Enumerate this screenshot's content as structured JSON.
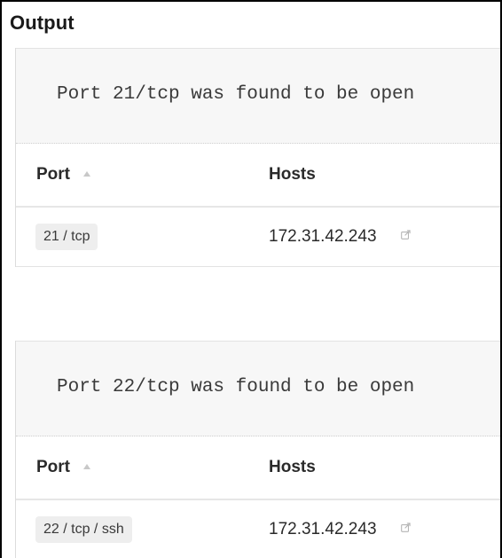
{
  "section": {
    "title": "Output"
  },
  "results": [
    {
      "message": "Port 21/tcp was found to be open",
      "columns": {
        "port": "Port",
        "hosts": "Hosts"
      },
      "rows": [
        {
          "port": "21 / tcp",
          "host": "172.31.42.243"
        }
      ]
    },
    {
      "message": "Port 22/tcp was found to be open",
      "columns": {
        "port": "Port",
        "hosts": "Hosts"
      },
      "rows": [
        {
          "port": "22 / tcp / ssh",
          "host": "172.31.42.243"
        }
      ]
    }
  ],
  "icons": {
    "sort": "sort-ascending-icon",
    "external_link": "external-link-icon"
  },
  "colors": {
    "panel_background": "#f7f7f7",
    "pill_background": "#eeeeee",
    "text": "#2a2a2a",
    "muted_icon": "#c8c8c8"
  }
}
